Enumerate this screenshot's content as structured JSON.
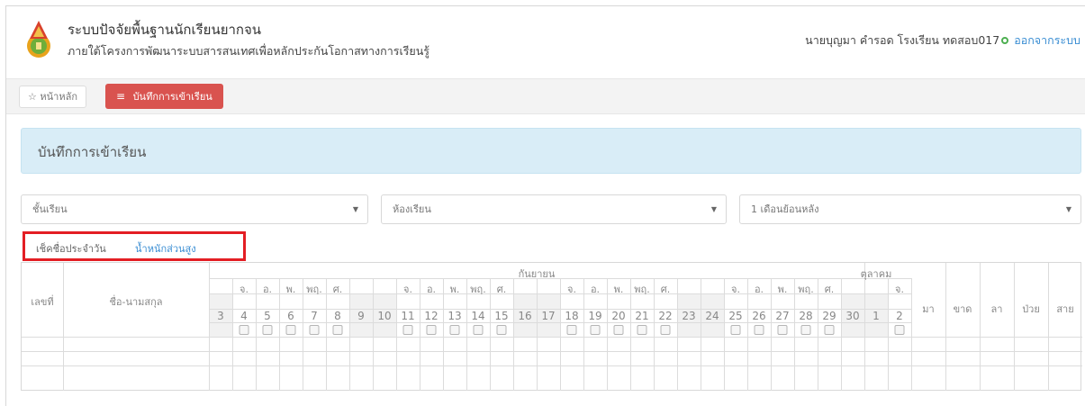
{
  "header": {
    "title": "ระบบปัจจัยพื้นฐานนักเรียนยากจน",
    "subtitle": "ภายใต้โครงการพัฒนาระบบสารสนเทศเพื่อหลักประกันโอกาสทางการเรียนรู้",
    "user_text": "นายบุญมา คำรอด  โรงเรียน ทดสอบ017",
    "logout": "ออกจากระบบ"
  },
  "nav": {
    "home_icon": "☆",
    "home_label": "หน้าหลัก",
    "active_icon": "≡",
    "active_label": "บันทึกการเข้าเรียน"
  },
  "panel": {
    "title": "บันทึกการเข้าเรียน"
  },
  "filters": {
    "grade": "ชั้นเรียน",
    "room": "ห้องเรียน",
    "period": "1 เดือนย้อนหลัง",
    "arrow_icon": "▼"
  },
  "tabs": {
    "daily": "เช็คชื่อประจำวัน",
    "weight": "น้ำหนักส่วนสูง"
  },
  "table": {
    "col_number": "เลขที่",
    "col_name": "ชื่อ-นามสกุล",
    "month_1": "กันยายน",
    "month_2": "ตุลาคม",
    "summary": [
      "มา",
      "ขาด",
      "ลา",
      "ป่วย",
      "สาย"
    ],
    "weekdays": [
      "จ.",
      "อ.",
      "พ.",
      "พฤ.",
      "ศ."
    ],
    "days": [
      "3",
      "4",
      "5",
      "6",
      "7",
      "8",
      "9",
      "10",
      "11",
      "12",
      "13",
      "14",
      "15",
      "16",
      "17",
      "18",
      "19",
      "20",
      "21",
      "22",
      "23",
      "24",
      "25",
      "26",
      "27",
      "28",
      "29",
      "30",
      "1",
      "2"
    ]
  }
}
